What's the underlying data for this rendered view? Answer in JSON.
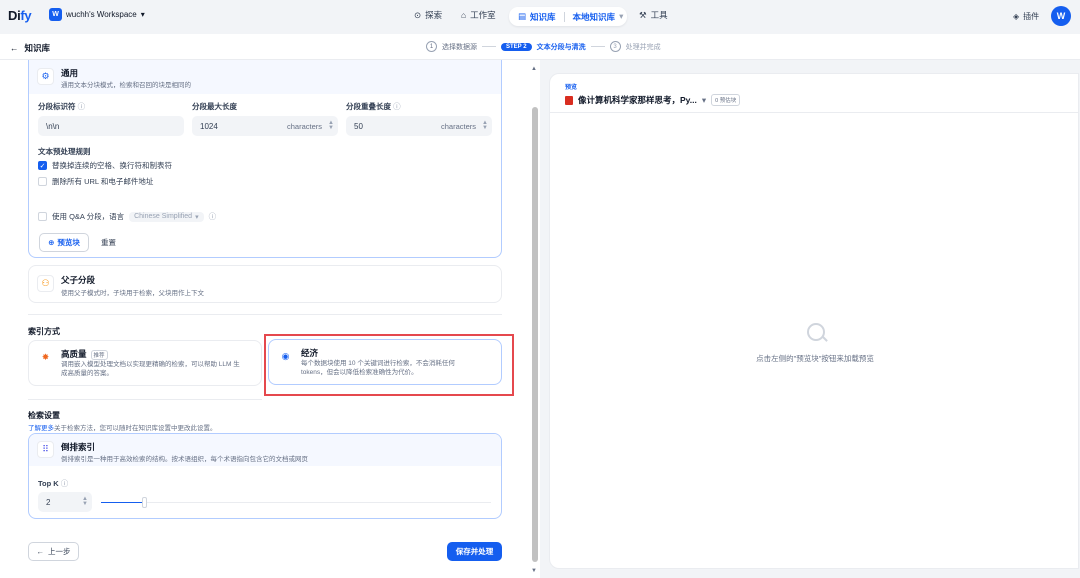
{
  "app": {
    "logo_main": "Di",
    "logo_accent": "fy",
    "workspace_initial": "W",
    "workspace_name": "wuchh's Workspace"
  },
  "nav": {
    "explore": "探索",
    "studio": "工作室",
    "knowledge": "知识库",
    "local_knowledge": "本地知识库",
    "tools": "工具",
    "plugins": "插件",
    "avatar": "W"
  },
  "subheader": {
    "back_label": "知识库",
    "steps": [
      {
        "num": "1",
        "label": "选择数据源"
      },
      {
        "num": "STEP 2",
        "label": "文本分段与清洗"
      },
      {
        "num": "3",
        "label": "处理并完成"
      }
    ]
  },
  "general": {
    "title": "通用",
    "desc": "通用文本分块模式，检索和召回的块是相同的",
    "delimiter_label": "分段标识符",
    "delimiter_value": "\\n\\n",
    "max_len_label": "分段最大长度",
    "max_len_value": "1024",
    "max_len_unit": "characters",
    "overlap_label": "分段重叠长度",
    "overlap_value": "50",
    "overlap_unit": "characters",
    "preprocess_label": "文本预处理规则",
    "rule1": "替换掉连续的空格、换行符和制表符",
    "rule2": "删除所有 URL 和电子邮件地址",
    "qa_label": "使用 Q&A 分段，语言",
    "qa_lang": "Chinese Simplified",
    "preview_btn": "预览块",
    "reset_btn": "重置"
  },
  "parent_child": {
    "title": "父子分段",
    "desc": "使用父子模式时，子块用于检索，父块用作上下文"
  },
  "index": {
    "section_title": "索引方式",
    "hq_title": "高质量",
    "hq_badge": "推荐",
    "hq_desc_1": "调用嵌入模型处理文档以实现更精确的检索，可以帮助 LLM 生",
    "hq_desc_2": "成高质量的答案。",
    "eco_title": "经济",
    "eco_desc_1": "每个数据块使用 10 个关键词进行检索，不会消耗任何",
    "eco_desc_2": "tokens，但会以降低检索准确性为代价。"
  },
  "retrieval": {
    "section_title": "检索设置",
    "link_text": "了解更多",
    "hint": "关于检索方法，您可以随时在知识库设置中更改此设置。",
    "method_title": "倒排索引",
    "method_desc": "倒排索引是一种用于高效检索的结构。按术语组织，每个术语指向包含它的文档或网页",
    "topk_label": "Top K",
    "topk_value": "2",
    "topk_slider_level": 0.11
  },
  "footer": {
    "prev_btn": "上一步",
    "save_btn": "保存并处理"
  },
  "preview": {
    "label": "预览",
    "doc_title": "像计算机科学家那样思考，Py...",
    "chunk_count": "0 预估块",
    "empty_text": "点击左侧的\"预览块\"按钮来加载预览"
  },
  "colors": {
    "accent": "#155eef",
    "highlight": "#e5484d"
  }
}
